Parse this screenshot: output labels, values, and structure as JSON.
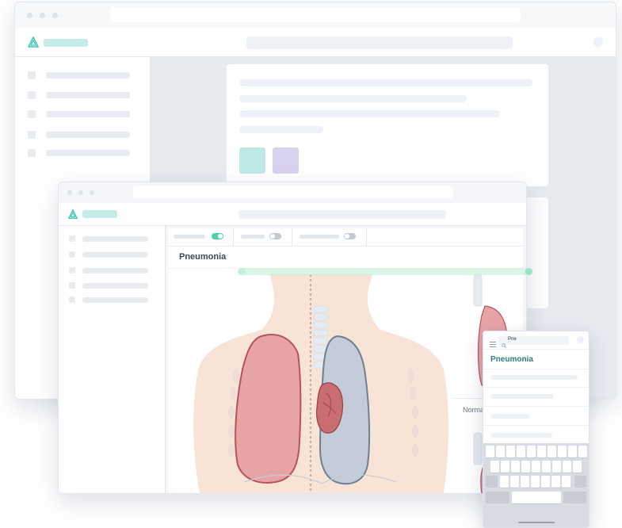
{
  "back_window": {
    "sidebar": {
      "items": [
        "",
        "",
        "",
        "",
        ""
      ]
    },
    "swatches": [
      {
        "color": "#bfe9e6"
      },
      {
        "color": "#d9d2ee"
      }
    ]
  },
  "front_window": {
    "page_title": "Pneumonia",
    "toggles": [
      {
        "on": true,
        "color": "#4fd0a8"
      },
      {
        "on": false,
        "color": "#c2c9d2"
      },
      {
        "on": false,
        "color": "#c2c9d2"
      }
    ],
    "figure": {
      "caption": "Normal",
      "left_lung_color": "#e7a3a6",
      "right_lung_color": "#c3ccd8",
      "skin_color": "#f8e4d6"
    }
  },
  "mobile": {
    "search_value": "Pne",
    "result_title": "Pneumonia",
    "menu_icon": "hamburger-icon",
    "search_icon": "magnifier-icon"
  },
  "colors": {
    "brand": "#3ec7b5"
  }
}
